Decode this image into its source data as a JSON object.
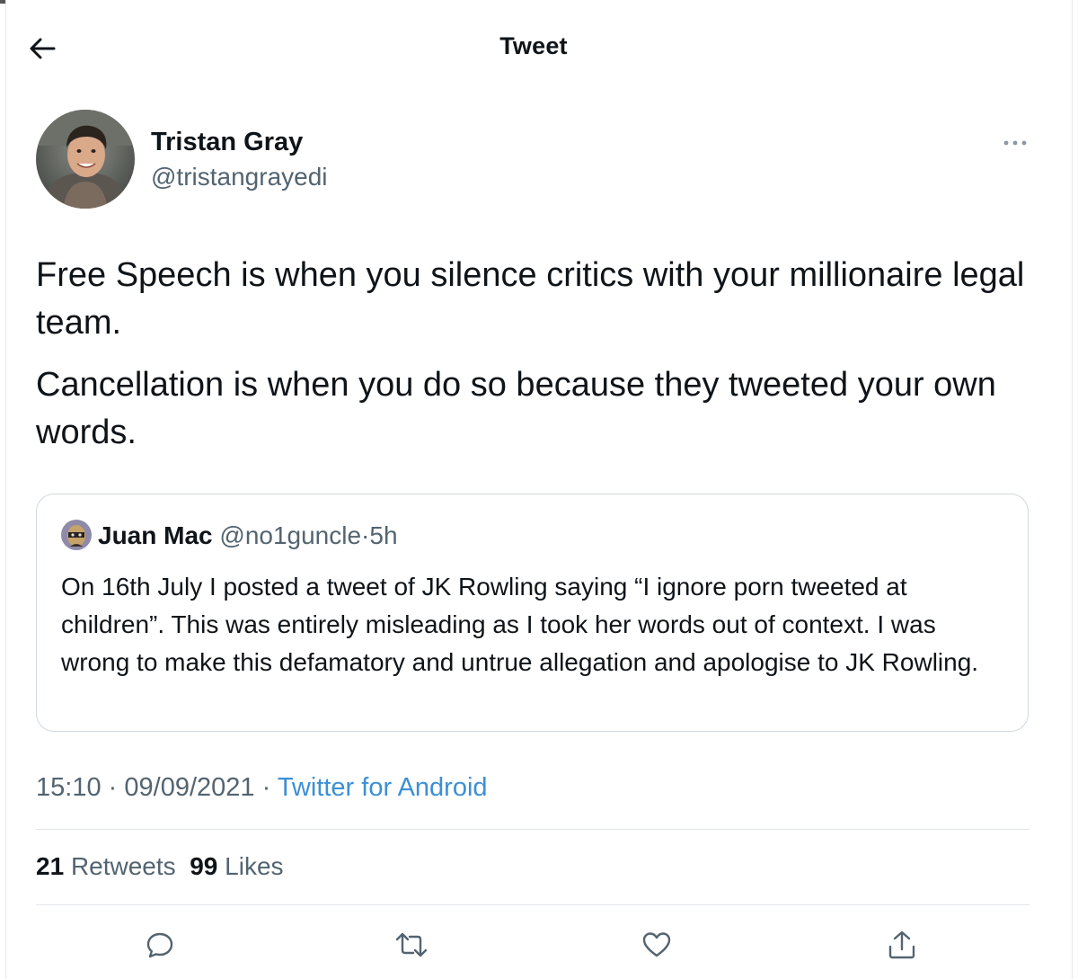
{
  "header": {
    "title": "Tweet",
    "back_icon": "arrow-left-icon"
  },
  "author": {
    "name": "Tristan Gray",
    "handle": "@tristangrayedi",
    "more_icon": "more-horizontal-icon"
  },
  "tweet": {
    "paragraphs": [
      "Free Speech is when you silence critics with your millionaire legal team.",
      "Cancellation is when you do so because they tweeted your own words."
    ]
  },
  "quoted_tweet": {
    "name": "Juan Mac",
    "handle": "@no1guncle",
    "separator": "·",
    "time": "5h",
    "text": "On 16th July I posted a tweet of JK Rowling saying “I ignore porn tweeted at children”. This was entirely misleading as I took her words out of context. I was wrong to make this defamatory and untrue allegation and apologise to JK Rowling."
  },
  "meta": {
    "time": "15:10",
    "date": "09/09/2021",
    "separator": "·",
    "source": "Twitter for Android"
  },
  "stats": {
    "retweets_count": "21",
    "retweets_label": "Retweets",
    "likes_count": "99",
    "likes_label": "Likes"
  },
  "actions": [
    {
      "name": "reply",
      "icon": "reply-icon"
    },
    {
      "name": "retweet",
      "icon": "retweet-icon"
    },
    {
      "name": "like",
      "icon": "heart-icon"
    },
    {
      "name": "share",
      "icon": "share-icon"
    }
  ],
  "colors": {
    "text_primary": "#0f1419",
    "text_secondary": "#536471",
    "link": "#3c8fd6",
    "border": "#cfd9de"
  }
}
